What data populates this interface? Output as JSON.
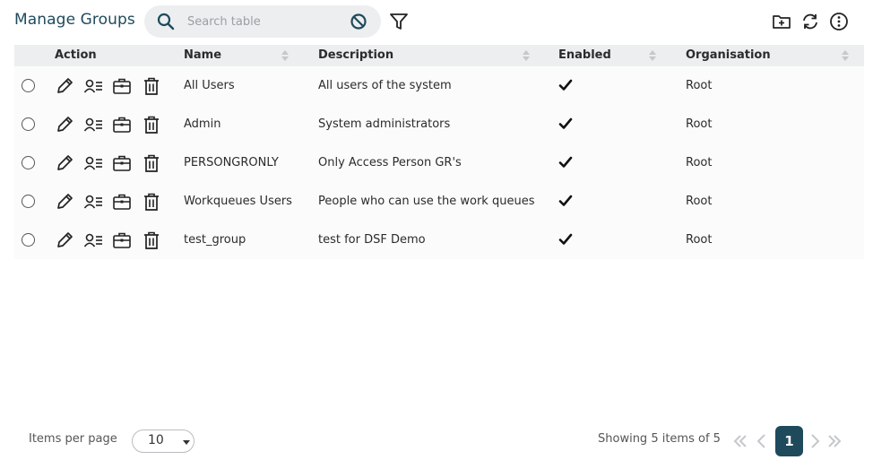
{
  "header": {
    "title": "Manage Groups",
    "search_placeholder": "Search table",
    "icons": [
      "search-icon",
      "clear-search-icon",
      "filter-icon",
      "new-folder-icon",
      "refresh-icon",
      "info-icon"
    ]
  },
  "table": {
    "columns": {
      "action": "Action",
      "name": "Name",
      "description": "Description",
      "enabled": "Enabled",
      "organisation": "Organisation"
    },
    "rows": [
      {
        "name": "All Users",
        "description": "All users of the system",
        "enabled": true,
        "organisation": "Root"
      },
      {
        "name": "Admin",
        "description": "System administrators",
        "enabled": true,
        "organisation": "Root"
      },
      {
        "name": "PERSONGRONLY",
        "description": "Only Access Person GR's",
        "enabled": true,
        "organisation": "Root"
      },
      {
        "name": "Workqueues Users",
        "description": "People who can use the work queues",
        "enabled": true,
        "organisation": "Root"
      },
      {
        "name": "test_group",
        "description": "test for DSF Demo",
        "enabled": true,
        "organisation": "Root"
      }
    ],
    "row_action_icons": [
      "edit-icon",
      "members-icon",
      "briefcase-icon",
      "delete-icon"
    ]
  },
  "footer": {
    "items_per_page_label": "Items per page",
    "items_per_page_value": "10",
    "showing_text": "Showing 5 items of 5",
    "current_page": "1"
  },
  "colors": {
    "accent": "#1f4a5c",
    "header_bg": "#eceeef",
    "row_bg": "#fbfbfb"
  }
}
